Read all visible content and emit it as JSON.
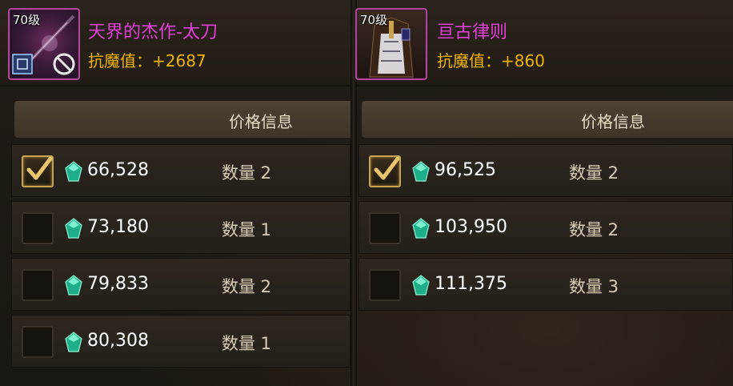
{
  "left_item": {
    "level": "70级",
    "name": "天界的杰作-太刀",
    "stat": "抗魔值：+2687",
    "icon": "katana-icon",
    "price_header": "价格信息",
    "listings": [
      {
        "price": "66,528",
        "qty": "数量 2",
        "checked": true
      },
      {
        "price": "73,180",
        "qty": "数量 1",
        "checked": false
      },
      {
        "price": "79,833",
        "qty": "数量 2",
        "checked": false
      },
      {
        "price": "80,308",
        "qty": "数量 1",
        "checked": false
      }
    ]
  },
  "right_item": {
    "level": "70级",
    "name": "亘古律则",
    "stat": "抗魔值：+860",
    "icon": "armor-icon",
    "price_header": "价格信息",
    "listings": [
      {
        "price": "96,525",
        "qty": "数量 2",
        "checked": true
      },
      {
        "price": "103,950",
        "qty": "数量 2",
        "checked": false
      },
      {
        "price": "111,375",
        "qty": "数量 3",
        "checked": false
      }
    ]
  },
  "colors": {
    "name": "#e23fd6",
    "stat": "#f0b400",
    "gem": "#2fd6a8",
    "check": "#e9c56b"
  }
}
